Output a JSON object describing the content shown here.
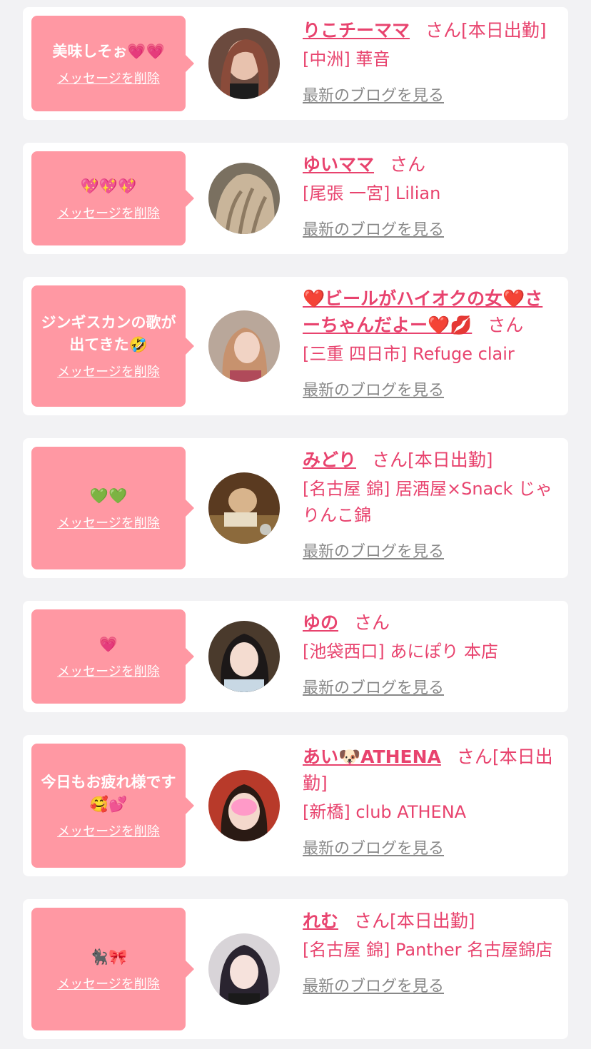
{
  "labels": {
    "delete_message": "メッセージを削除",
    "latest_blog": "最新のブログを見る",
    "san": "さん"
  },
  "colors": {
    "accent": "#e8436e",
    "bubble": "#ff98a3",
    "link_gray": "#888888",
    "background": "#f2f2f4"
  },
  "items": [
    {
      "message": "美味しそぉ💗💗",
      "name": "りこチーママ",
      "status": "[本日出勤]",
      "shop": "[中洲] 華音",
      "avatar_icon": "avatar-photo"
    },
    {
      "message": "💖💖💖",
      "name": "ゆいママ",
      "status": "",
      "shop": "[尾張 一宮] Lilian",
      "avatar_icon": "avatar-photo"
    },
    {
      "message": "ジンギスカンの歌が出てきた🤣",
      "name": "❤️ビールがハイオクの女❤️さーちゃんだよー❤️💋",
      "status": "",
      "shop": "[三重 四日市] Refuge clair",
      "avatar_icon": "avatar-photo"
    },
    {
      "message": "💚💚",
      "name": "みどり",
      "status": "[本日出勤]",
      "shop": "[名古屋 錦] 居酒屋×Snack じゃりんこ錦",
      "avatar_icon": "avatar-photo"
    },
    {
      "message": "💗",
      "name": "ゆの",
      "status": "",
      "shop": "[池袋西口] あにぽり 本店",
      "avatar_icon": "avatar-photo"
    },
    {
      "message": "今日もお疲れ様です🥰💕",
      "name": "あい🐶ATHENA",
      "status": "[本日出勤]",
      "shop": "[新橋] club ATHENA",
      "avatar_icon": "avatar-photo"
    },
    {
      "message": "🐈‍⬛🎀",
      "name": "れむ",
      "status": "[本日出勤]",
      "shop": "[名古屋 錦] Panther 名古屋錦店",
      "avatar_icon": "avatar-photo"
    }
  ]
}
